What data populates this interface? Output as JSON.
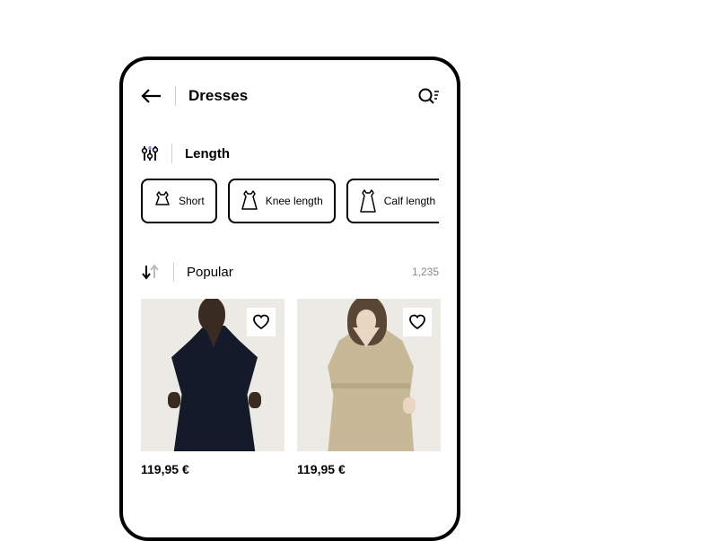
{
  "header": {
    "title": "Dresses"
  },
  "filter": {
    "label": "Length",
    "chips": [
      {
        "label": "Short"
      },
      {
        "label": "Knee length"
      },
      {
        "label": "Calf length"
      },
      {
        "label": ""
      }
    ]
  },
  "sort": {
    "label": "Popular",
    "count": "1,235"
  },
  "products": [
    {
      "price": "119,95 €"
    },
    {
      "price": "119,95 €"
    }
  ]
}
